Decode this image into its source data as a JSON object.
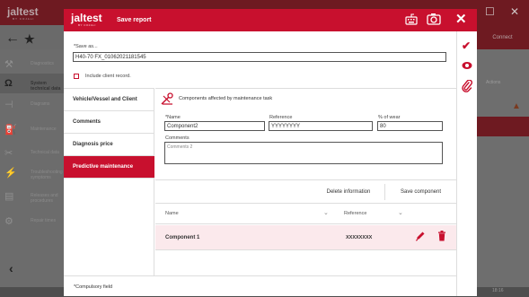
{
  "background": {
    "logo": "jaltest",
    "logo_sub": "BY COJALI",
    "connect_label": "Connect",
    "actions_label": "Actions",
    "clock": "18:16",
    "sidebar_items": [
      {
        "label": "Diagnostics",
        "icon": "wrench-icon"
      },
      {
        "label": "System technical data",
        "icon": "omega-icon"
      },
      {
        "label": "Diagrams",
        "icon": "diagram-icon"
      },
      {
        "label": "Maintenance",
        "icon": "oil-icon"
      },
      {
        "label": "Technical data",
        "icon": "tools-icon"
      },
      {
        "label": "Troubleshooting symptoms",
        "icon": "symptom-icon"
      },
      {
        "label": "Releases and procedures",
        "icon": "procedure-icon"
      },
      {
        "label": "Repair times",
        "icon": "gear-icon"
      }
    ]
  },
  "modal": {
    "logo": "jaltest",
    "logo_sub": "BY COJALI",
    "title": "Save report",
    "save_as_label": "*Save as...",
    "save_as_value": "H40-70 FX_01062021181545",
    "include_client_label": "Include client record.",
    "tabs": [
      {
        "label": "Vehicle/Vessel and Client",
        "active": false
      },
      {
        "label": "Comments",
        "active": false
      },
      {
        "label": "Diagnosis price",
        "active": false
      },
      {
        "label": "Predictive maintenance",
        "active": true
      }
    ],
    "footer_note": "*Compulsory field",
    "content": {
      "task_title": "Components affected by maintenance task",
      "name_label": "*Name",
      "name_value": "Component2",
      "reference_label": "Reference",
      "reference_value": "YYYYYYYY",
      "wear_label": "% of wear",
      "wear_value": "80",
      "comments_label": "Comments",
      "comments_value": "Comments 2",
      "delete_label": "Delete information",
      "save_label": "Save component",
      "table": {
        "headers": [
          "Name",
          "Reference"
        ],
        "rows": [
          {
            "name": "Component 1",
            "reference": "XXXXXXXX"
          }
        ]
      }
    }
  },
  "colors": {
    "accent": "#c8102e",
    "row_highlight": "#fbe9ec"
  }
}
